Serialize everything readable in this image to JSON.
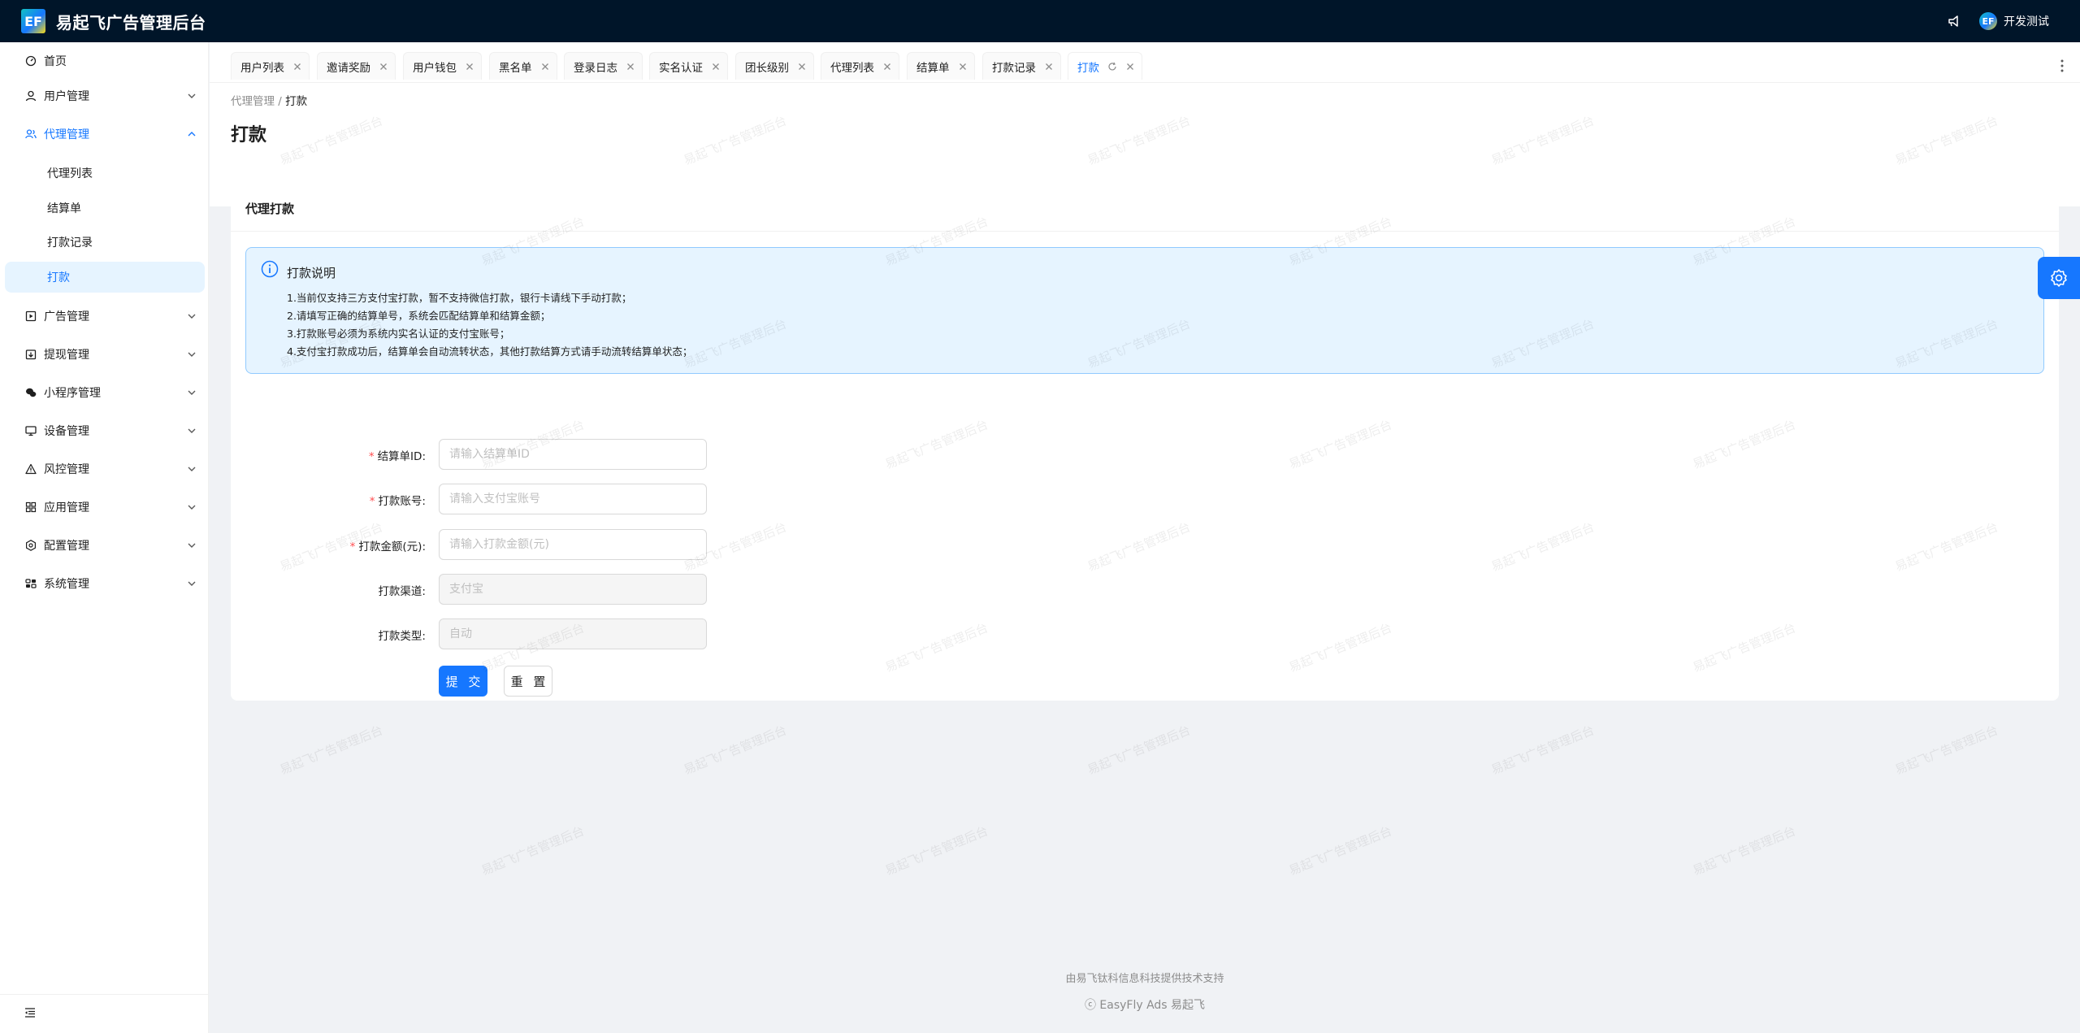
{
  "app": {
    "logo_text": "EF",
    "title": "易起飞广告管理后台"
  },
  "header": {
    "user_name": "开发测试",
    "avatar_text": "EF"
  },
  "sidebar": {
    "home": "首页",
    "items": [
      {
        "label": "用户管理",
        "icon": "user-icon"
      },
      {
        "label": "代理管理",
        "icon": "agent-icon"
      },
      {
        "label": "广告管理",
        "icon": "ad-icon"
      },
      {
        "label": "提现管理",
        "icon": "withdraw-icon"
      },
      {
        "label": "小程序管理",
        "icon": "wechat-icon"
      },
      {
        "label": "设备管理",
        "icon": "device-icon"
      },
      {
        "label": "风控管理",
        "icon": "warning-icon"
      },
      {
        "label": "应用管理",
        "icon": "apps-icon"
      },
      {
        "label": "配置管理",
        "icon": "settings-icon"
      },
      {
        "label": "系统管理",
        "icon": "system-icon"
      }
    ],
    "sub_items": [
      "代理列表",
      "结算单",
      "打款记录",
      "打款"
    ]
  },
  "tabs": [
    "用户列表",
    "邀请奖励",
    "用户钱包",
    "黑名单",
    "登录日志",
    "实名认证",
    "团长级别",
    "代理列表",
    "结算单",
    "打款记录",
    "打款"
  ],
  "breadcrumb": {
    "parent": "代理管理",
    "separator": "/",
    "current": "打款"
  },
  "page": {
    "title": "打款"
  },
  "card": {
    "title": "代理打款"
  },
  "alert": {
    "title": "打款说明",
    "lines": [
      "1.当前仅支持三方支付宝打款，暂不支持微信打款，银行卡请线下手动打款；",
      "2.请填写正确的结算单号，系统会匹配结算单和结算金额；",
      "3.打款账号必须为系统内实名认证的支付宝账号；",
      "4.支付宝打款成功后，结算单会自动流转状态，其他打款结算方式请手动流转结算单状态；"
    ]
  },
  "form": {
    "settlement_id": {
      "label": "结算单ID:",
      "placeholder": "请输入结算单ID"
    },
    "account": {
      "label": "打款账号:",
      "placeholder": "请输入支付宝账号"
    },
    "amount": {
      "label": "打款金额(元):",
      "placeholder": "请输入打款金额(元)"
    },
    "channel": {
      "label": "打款渠道:",
      "placeholder": "支付宝"
    },
    "type": {
      "label": "打款类型:",
      "placeholder": "自动"
    },
    "submit": "提 交",
    "reset": "重 置"
  },
  "footer": {
    "line1": "由易飞钛科信息科技提供技术支持",
    "line2": "ⓒ EasyFly Ads 易起飞"
  },
  "watermark": "易起飞广告管理后台",
  "colors": {
    "primary": "#1677ff",
    "header_bg": "#001529",
    "alert_bg": "#e6f4ff",
    "required": "#ff4d4f"
  }
}
